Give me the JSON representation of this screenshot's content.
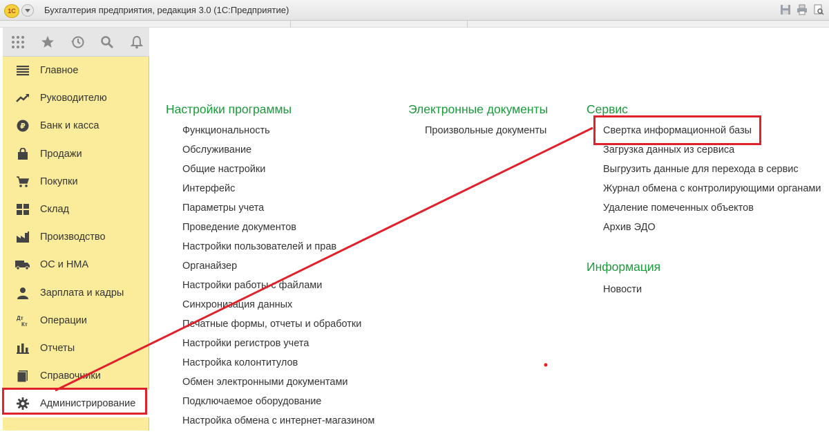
{
  "window": {
    "logo_text": "1С",
    "title": "Бухгалтерия предприятия, редакция 3.0  (1С:Предприятие)"
  },
  "toolbar": {
    "icons": [
      "apps-grid-icon",
      "star-icon",
      "history-icon",
      "search-icon",
      "bell-icon"
    ]
  },
  "sidebar": {
    "items": [
      {
        "label": "Главное",
        "icon": "menu-lines-icon"
      },
      {
        "label": "Руководителю",
        "icon": "trend-icon"
      },
      {
        "label": "Банк и касса",
        "icon": "ruble-coin-icon"
      },
      {
        "label": "Продажи",
        "icon": "shopping-bag-icon"
      },
      {
        "label": "Покупки",
        "icon": "cart-icon"
      },
      {
        "label": "Склад",
        "icon": "warehouse-grid-icon"
      },
      {
        "label": "Производство",
        "icon": "factory-icon"
      },
      {
        "label": "ОС и НМА",
        "icon": "truck-icon"
      },
      {
        "label": "Зарплата и кадры",
        "icon": "person-icon"
      },
      {
        "label": "Операции",
        "icon": "dt-kt-icon"
      },
      {
        "label": "Отчеты",
        "icon": "bar-chart-icon"
      },
      {
        "label": "Справочники",
        "icon": "books-icon"
      },
      {
        "label": "Администрирование",
        "icon": "gear-icon"
      }
    ],
    "active": "Администрирование"
  },
  "dt_kt": {
    "top": "Дт",
    "bottom": "Кт"
  },
  "main": {
    "settings": {
      "title": "Настройки программы",
      "links": [
        "Функциональность",
        "Обслуживание",
        "Общие настройки",
        "Интерфейс",
        "Параметры учета",
        "Проведение документов",
        "Настройки пользователей и прав",
        "Органайзер",
        "Настройки работы с файлами",
        "Синхронизация данных",
        "Печатные формы, отчеты и обработки",
        "Настройки регистров учета",
        "Настройка колонтитулов",
        "Обмен электронными документами",
        "Подключаемое оборудование",
        "Настройка обмена с интернет-магазином"
      ]
    },
    "edocs": {
      "title": "Электронные документы",
      "links": [
        "Произвольные документы"
      ]
    },
    "service": {
      "title": "Сервис",
      "links": [
        "Свертка информационной базы",
        "Загрузка данных из сервиса",
        "Выгрузить данные для перехода в сервис",
        "Журнал обмена с контролирующими органами",
        "Удаление помеченных объектов",
        "Архив ЭДО"
      ]
    },
    "info": {
      "title": "Информация",
      "links": [
        "Новости"
      ]
    }
  },
  "annotation_color": "#e0202a"
}
